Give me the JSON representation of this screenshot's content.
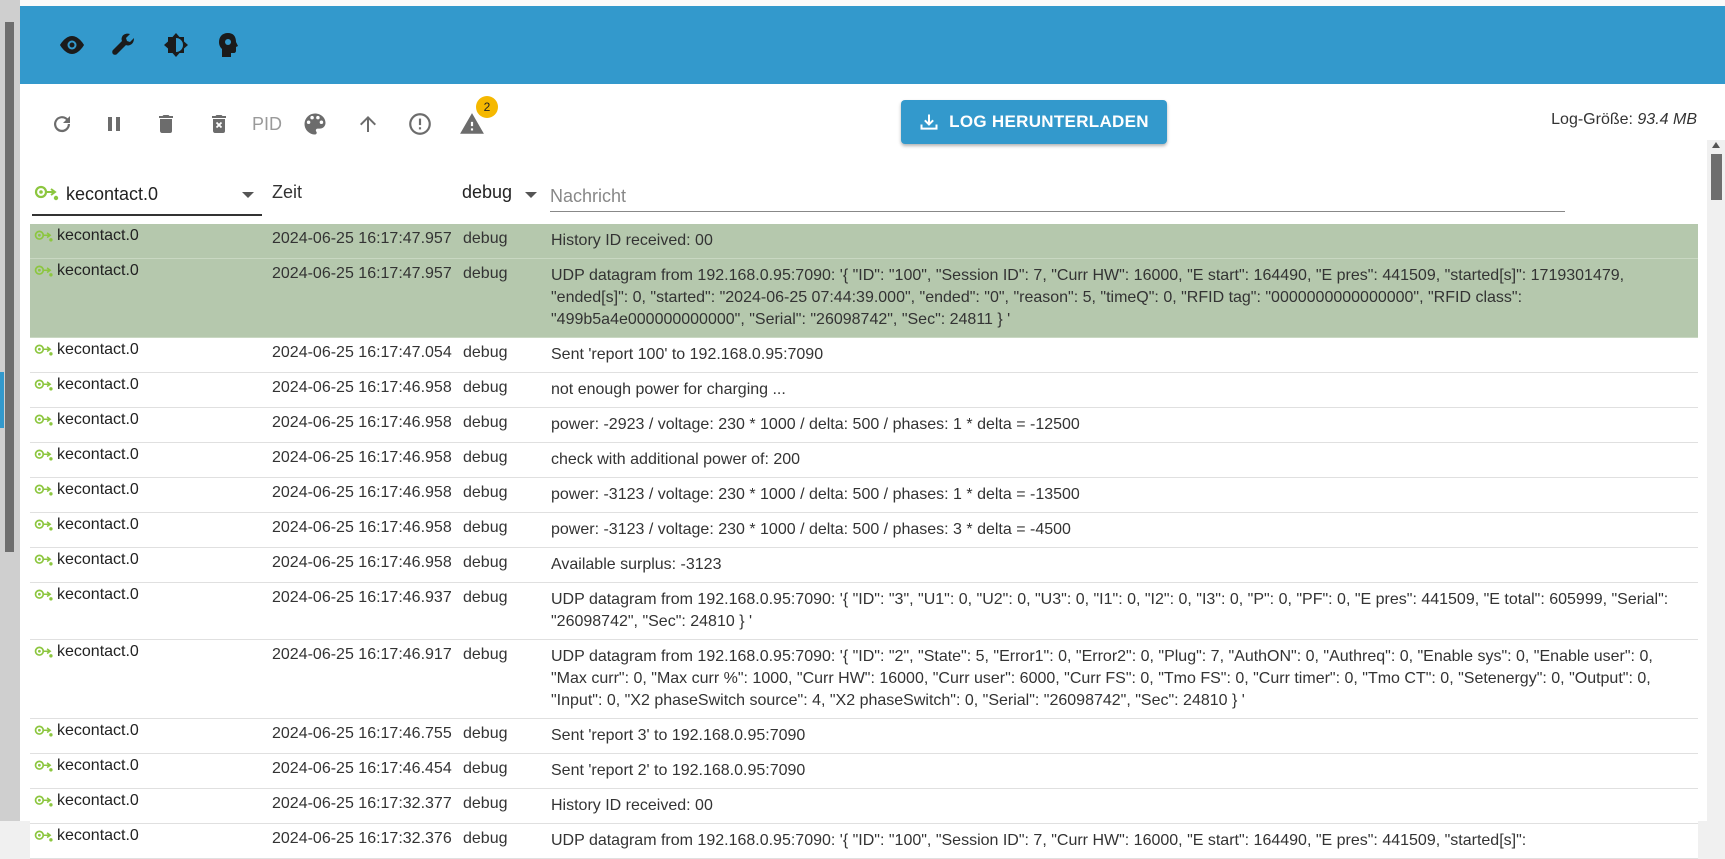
{
  "header": {
    "icons": [
      "eye-icon",
      "wrench-icon",
      "brightness-icon",
      "head-icon"
    ]
  },
  "toolbar": {
    "pid_label": "PID",
    "warning_count": "2",
    "download_label": "LOG HERUNTERLADEN",
    "logsize_label": "Log-Größe:",
    "logsize_value": "93.4 MB"
  },
  "filters": {
    "instance": "kecontact.0",
    "time_label": "Zeit",
    "level": "debug",
    "message_placeholder": "Nachricht"
  },
  "colors": {
    "accent": "#3399cc",
    "highlight_row": "#b5c8ad",
    "badge": "#f5b800",
    "adapter_icon": "#8cc63f"
  },
  "rows": [
    {
      "instance": "kecontact.0",
      "time": "2024-06-25 16:17:47.957",
      "level": "debug",
      "message": "History ID received: 00",
      "highlight": true
    },
    {
      "instance": "kecontact.0",
      "time": "2024-06-25 16:17:47.957",
      "level": "debug",
      "message": "UDP datagram from 192.168.0.95:7090: '{ \"ID\": \"100\", \"Session ID\": 7, \"Curr HW\": 16000, \"E start\": 164490, \"E pres\": 441509, \"started[s]\": 1719301479, \"ended[s]\": 0, \"started\": \"2024-06-25 07:44:39.000\", \"ended\": \"0\", \"reason\": 5, \"timeQ\": 0, \"RFID tag\": \"0000000000000000\", \"RFID class\": \"499b5a4e000000000000\", \"Serial\": \"26098742\", \"Sec\": 24811 } '",
      "highlight": true
    },
    {
      "instance": "kecontact.0",
      "time": "2024-06-25 16:17:47.054",
      "level": "debug",
      "message": "Sent 'report 100' to 192.168.0.95:7090",
      "highlight": false
    },
    {
      "instance": "kecontact.0",
      "time": "2024-06-25 16:17:46.958",
      "level": "debug",
      "message": "not enough power for charging ...",
      "highlight": false
    },
    {
      "instance": "kecontact.0",
      "time": "2024-06-25 16:17:46.958",
      "level": "debug",
      "message": "power: -2923 / voltage: 230 * 1000 / delta: 500 / phases: 1 * delta = -12500",
      "highlight": false
    },
    {
      "instance": "kecontact.0",
      "time": "2024-06-25 16:17:46.958",
      "level": "debug",
      "message": "check with additional power of: 200",
      "highlight": false
    },
    {
      "instance": "kecontact.0",
      "time": "2024-06-25 16:17:46.958",
      "level": "debug",
      "message": "power: -3123 / voltage: 230 * 1000 / delta: 500 / phases: 1 * delta = -13500",
      "highlight": false
    },
    {
      "instance": "kecontact.0",
      "time": "2024-06-25 16:17:46.958",
      "level": "debug",
      "message": "power: -3123 / voltage: 230 * 1000 / delta: 500 / phases: 3 * delta = -4500",
      "highlight": false
    },
    {
      "instance": "kecontact.0",
      "time": "2024-06-25 16:17:46.958",
      "level": "debug",
      "message": "Available surplus: -3123",
      "highlight": false
    },
    {
      "instance": "kecontact.0",
      "time": "2024-06-25 16:17:46.937",
      "level": "debug",
      "message": "UDP datagram from 192.168.0.95:7090: '{ \"ID\": \"3\", \"U1\": 0, \"U2\": 0, \"U3\": 0, \"I1\": 0, \"I2\": 0, \"I3\": 0, \"P\": 0, \"PF\": 0, \"E pres\": 441509, \"E total\": 605999, \"Serial\": \"26098742\", \"Sec\": 24810 } '",
      "highlight": false
    },
    {
      "instance": "kecontact.0",
      "time": "2024-06-25 16:17:46.917",
      "level": "debug",
      "message": "UDP datagram from 192.168.0.95:7090: '{ \"ID\": \"2\", \"State\": 5, \"Error1\": 0, \"Error2\": 0, \"Plug\": 7, \"AuthON\": 0, \"Authreq\": 0, \"Enable sys\": 0, \"Enable user\": 0, \"Max curr\": 0, \"Max curr %\": 1000, \"Curr HW\": 16000, \"Curr user\": 6000, \"Curr FS\": 0, \"Tmo FS\": 0, \"Curr timer\": 0, \"Tmo CT\": 0, \"Setenergy\": 0, \"Output\": 0, \"Input\": 0, \"X2 phaseSwitch source\": 4, \"X2 phaseSwitch\": 0, \"Serial\": \"26098742\", \"Sec\": 24810 } '",
      "highlight": false
    },
    {
      "instance": "kecontact.0",
      "time": "2024-06-25 16:17:46.755",
      "level": "debug",
      "message": "Sent 'report 3' to 192.168.0.95:7090",
      "highlight": false
    },
    {
      "instance": "kecontact.0",
      "time": "2024-06-25 16:17:46.454",
      "level": "debug",
      "message": "Sent 'report 2' to 192.168.0.95:7090",
      "highlight": false
    },
    {
      "instance": "kecontact.0",
      "time": "2024-06-25 16:17:32.377",
      "level": "debug",
      "message": "History ID received: 00",
      "highlight": false
    },
    {
      "instance": "kecontact.0",
      "time": "2024-06-25 16:17:32.376",
      "level": "debug",
      "message": "UDP datagram from 192.168.0.95:7090: '{ \"ID\": \"100\", \"Session ID\": 7, \"Curr HW\": 16000, \"E start\": 164490, \"E pres\": 441509, \"started[s]\":",
      "highlight": false
    }
  ]
}
